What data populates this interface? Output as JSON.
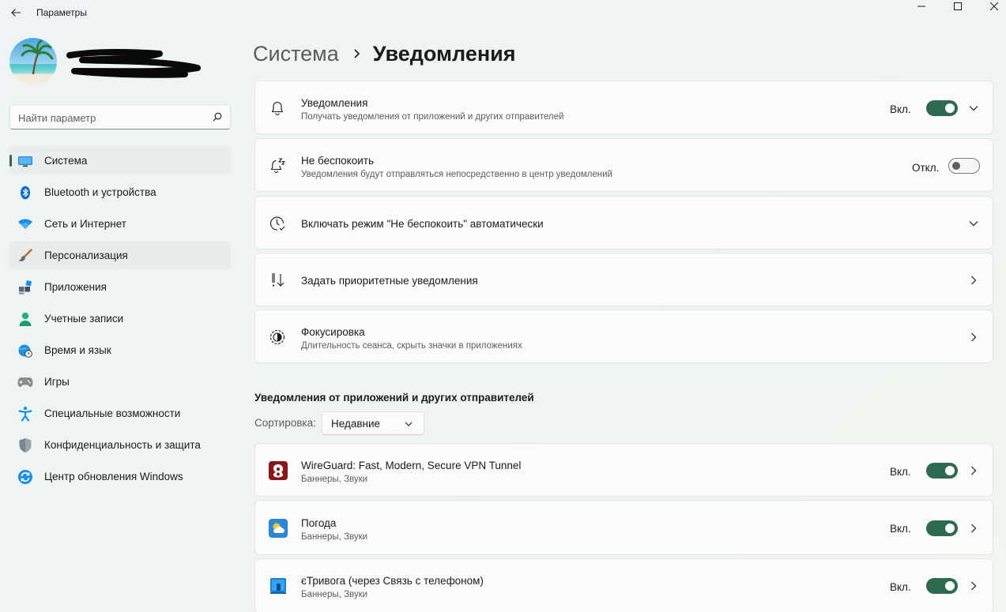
{
  "window": {
    "title": "Параметры"
  },
  "user": {
    "name": "",
    "email": ""
  },
  "search": {
    "placeholder": "Найти параметр"
  },
  "sidebar": {
    "items": [
      {
        "label": "Система",
        "icon": "system-display-icon",
        "active": true
      },
      {
        "label": "Bluetooth и устройства",
        "icon": "bluetooth-icon"
      },
      {
        "label": "Сеть и Интернет",
        "icon": "wifi-icon"
      },
      {
        "label": "Персонализация",
        "icon": "brush-icon"
      },
      {
        "label": "Приложения",
        "icon": "apps-icon"
      },
      {
        "label": "Учетные записи",
        "icon": "account-icon"
      },
      {
        "label": "Время и язык",
        "icon": "globe-clock-icon"
      },
      {
        "label": "Игры",
        "icon": "gamepad-icon"
      },
      {
        "label": "Специальные возможности",
        "icon": "accessibility-icon"
      },
      {
        "label": "Конфиденциальность и защита",
        "icon": "shield-icon"
      },
      {
        "label": "Центр обновления Windows",
        "icon": "windows-update-icon"
      }
    ]
  },
  "breadcrumb": {
    "parent": "Система",
    "current": "Уведомления"
  },
  "cards": {
    "notifications": {
      "title": "Уведомления",
      "subtitle": "Получать уведомления от приложений и других отправителей",
      "state": "Вкл.",
      "on": true
    },
    "dnd": {
      "title": "Не беспокоить",
      "subtitle": "Уведомления будут отправляться непосредственно в центр уведомлений",
      "state": "Откл.",
      "on": false
    },
    "dnd_auto": {
      "title": "Включать режим \"Не беспокоить\" автоматически"
    },
    "priority": {
      "title": "Задать приоритетные уведомления"
    },
    "focus": {
      "title": "Фокусировка",
      "subtitle": "Длительность сеанса, скрыть значки в приложениях"
    }
  },
  "apps_section": {
    "title": "Уведомления от приложений и других отправителей",
    "sort_label": "Сортировка:",
    "sort_value": "Недавние",
    "apps": [
      {
        "name": "WireGuard: Fast, Modern, Secure VPN Tunnel",
        "detail": "Баннеры, Звуки",
        "state": "Вкл.",
        "on": true,
        "icon": "wireguard-icon"
      },
      {
        "name": "Погода",
        "detail": "Баннеры, Звуки",
        "state": "Вкл.",
        "on": true,
        "icon": "weather-icon"
      },
      {
        "name": "єТривога (через Связь с телефоном)",
        "detail": "Баннеры, Звуки",
        "state": "Вкл.",
        "on": true,
        "icon": "phone-link-icon"
      }
    ]
  },
  "colors": {
    "accent": "#2d6a4f",
    "card_bg": "#fbfbfb",
    "text_primary": "#1b1b1b",
    "text_secondary": "#5d5d5d"
  }
}
